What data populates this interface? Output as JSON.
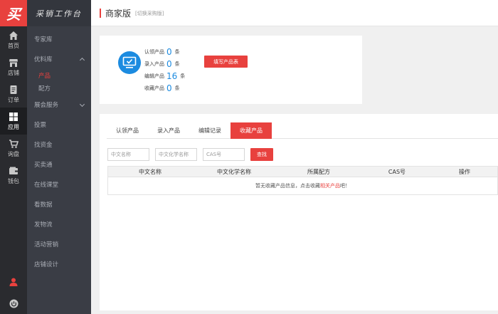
{
  "logo": {
    "mark": "买"
  },
  "rail": {
    "items": [
      {
        "label": "首页",
        "icon": "home-icon"
      },
      {
        "label": "店铺",
        "icon": "store-icon"
      },
      {
        "label": "订单",
        "icon": "order-icon"
      },
      {
        "label": "应用",
        "icon": "apps-icon",
        "active": true
      },
      {
        "label": "询盘",
        "icon": "cart-icon"
      },
      {
        "label": "钱包",
        "icon": "wallet-icon"
      }
    ],
    "bottom": [
      {
        "icon": "user-icon"
      },
      {
        "icon": "power-icon"
      }
    ]
  },
  "menu": {
    "title": "采销工作台",
    "items": {
      "expert": "专家库",
      "excellent": "优料库",
      "excellent_sub": [
        "产品",
        "配方"
      ],
      "exhibition": "展会服务",
      "bidding": "投票",
      "funding": "找资金",
      "trade": "买卖通",
      "classroom": "在线课堂",
      "data": "看数据",
      "logistics": "发物流",
      "marketing": "活动营销",
      "design": "店铺设计"
    }
  },
  "topbar": {
    "title": "商家版",
    "switch": "[切换采购版]"
  },
  "stats": {
    "rows": [
      {
        "label": "认领产品",
        "value": "0",
        "unit": "条"
      },
      {
        "label": "录入产品",
        "value": "0",
        "unit": "条"
      },
      {
        "label": "编辑产品",
        "value": "16",
        "unit": "条"
      },
      {
        "label": "收藏产品",
        "value": "0",
        "unit": "条"
      }
    ],
    "fill_button": "填写产品表"
  },
  "tabs": [
    "认领产品",
    "录入产品",
    "编辑记录",
    "收藏产品"
  ],
  "filters": {
    "cn_name": "中文名称",
    "cn_chem_name": "中文化学名称",
    "cas": "CAS号",
    "search_button": "查找"
  },
  "table": {
    "headers": [
      "中文名称",
      "中文化学名称",
      "所属配方",
      "CAS号",
      "操作"
    ],
    "empty_prefix": "暂无收藏产品信息，点击收藏",
    "empty_link": "相关产品",
    "empty_suffix": "吧！"
  },
  "colors": {
    "accent": "#e8413e",
    "blue": "#1c8be0",
    "rail": "#2a2b2f",
    "menu": "#3a3d45"
  }
}
